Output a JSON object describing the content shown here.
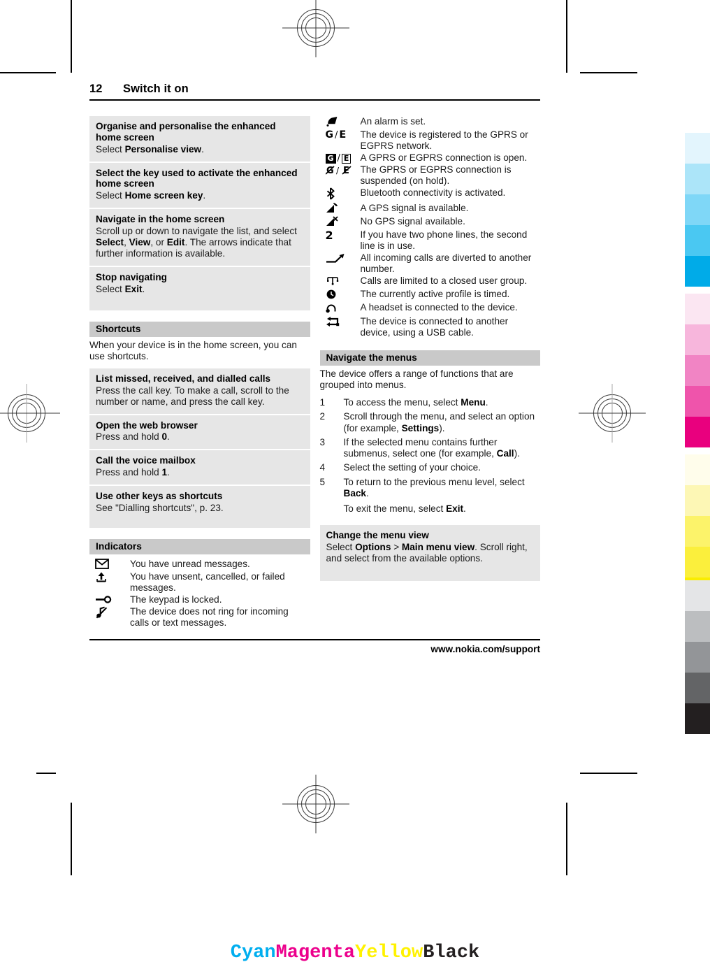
{
  "page": {
    "number": "12",
    "title": "Switch it on",
    "footer": "www.nokia.com/support"
  },
  "left_column": {
    "boxes": [
      {
        "heading": "Organise and personalise the enhanced home screen",
        "body_prefix": "Select ",
        "body_bold": "Personalise view",
        "body_suffix": "."
      },
      {
        "heading": "Select the key used to activate the enhanced home screen",
        "body_prefix": "Select ",
        "body_bold": "Home screen key",
        "body_suffix": "."
      },
      {
        "heading": "Navigate in the home screen",
        "body_prefix": "Scroll up or down to navigate the list, and select ",
        "body_bold": "Select",
        "body_mid1": ", ",
        "body_bold2": "View",
        "body_mid2": ", or ",
        "body_bold3": "Edit",
        "body_suffix": ". The arrows indicate that further information is available."
      },
      {
        "heading": "Stop navigating",
        "body_prefix": "Select ",
        "body_bold": "Exit",
        "body_suffix": "."
      }
    ],
    "shortcuts": {
      "band_title": "Shortcuts",
      "intro": "When your device is in the home screen, you can use shortcuts.",
      "boxes": [
        {
          "heading": "List missed, received, and dialled calls",
          "body": "Press the call key. To make a call, scroll to the number or name, and press the call key."
        },
        {
          "heading": "Open the web browser",
          "body_prefix": "Press and hold ",
          "body_bold": "0",
          "body_suffix": "."
        },
        {
          "heading": "Call the voice mailbox",
          "body_prefix": "Press and hold ",
          "body_bold": "1",
          "body_suffix": "."
        },
        {
          "heading": "Use other keys as shortcuts",
          "body": "See \"Dialling shortcuts\", p. 23."
        }
      ]
    },
    "indicators": {
      "band_title": "Indicators",
      "rows": [
        {
          "icon": "envelope-icon",
          "text": "You have unread messages."
        },
        {
          "icon": "outbox-arrow-up-icon",
          "text": "You have unsent, cancelled, or failed messages."
        },
        {
          "icon": "keypad-lock-key-icon",
          "text": "The keypad is locked."
        },
        {
          "icon": "silent-note-icon",
          "text": "The device does not ring for incoming calls or text messages."
        }
      ]
    }
  },
  "right_column": {
    "indicators": {
      "rows": [
        {
          "icon": "alarm-bell-icon",
          "text": "An alarm is set."
        },
        {
          "icon": "gprs-egprs-registered-icon",
          "text": "The device is registered to the GPRS or EGPRS network."
        },
        {
          "icon": "gprs-egprs-connection-open-icon",
          "text": "A GPRS or EGPRS connection is open."
        },
        {
          "icon": "gprs-egprs-suspended-icon",
          "text": "The GPRS or EGPRS connection is suspended (on hold)."
        },
        {
          "icon": "bluetooth-icon",
          "text": "Bluetooth connectivity is activated."
        },
        {
          "icon": "gps-signal-available-icon",
          "text": "A GPS signal is available."
        },
        {
          "icon": "gps-no-signal-icon",
          "text": "No GPS signal available."
        },
        {
          "icon": "line-two-icon",
          "text": "If you have two phone lines, the second line is in use."
        },
        {
          "icon": "call-divert-arrow-icon",
          "text": "All incoming calls are diverted to another number."
        },
        {
          "icon": "closed-user-group-icon",
          "text": "Calls are limited to a closed user group."
        },
        {
          "icon": "timed-profile-clock-icon",
          "text": "The currently active profile is timed."
        },
        {
          "icon": "headset-icon",
          "text": "A headset is connected to the device."
        },
        {
          "icon": "usb-cable-icon",
          "text": "The device is connected to another device, using a USB cable."
        }
      ]
    },
    "navigate_menus": {
      "band_title": "Navigate the menus",
      "intro": "The device offers a range of functions that are grouped into menus.",
      "steps": [
        {
          "n": "1",
          "prefix": "To access the menu, select ",
          "bold": "Menu",
          "suffix": "."
        },
        {
          "n": "2",
          "prefix": "Scroll through the menu, and select an option (for example, ",
          "bold": "Settings",
          "suffix": ")."
        },
        {
          "n": "3",
          "prefix": "If the selected menu contains further submenus, select one (for example, ",
          "bold": "Call",
          "suffix": ")."
        },
        {
          "n": "4",
          "prefix": "Select the setting of your choice.",
          "bold": "",
          "suffix": ""
        },
        {
          "n": "5",
          "prefix": "To return to the previous menu level, select ",
          "bold": "Back",
          "suffix": "."
        }
      ],
      "exit_prefix": "To exit the menu, select ",
      "exit_bold": "Exit",
      "exit_suffix": "."
    },
    "change_menu_view": {
      "heading": "Change the menu view",
      "body_prefix": "Select ",
      "body_bold1": "Options",
      "body_mid": " > ",
      "body_bold2": "Main menu view",
      "body_suffix": ". Scroll right, and select from the available options."
    }
  },
  "print_marks": {
    "cmyk_labels": [
      "Cyan",
      "Magenta",
      "Yellow",
      "Black"
    ],
    "cmyk_colors": [
      "#00aeef",
      "#ec008c",
      "#fff200",
      "#231f20"
    ],
    "cyan_ramp": [
      "#e3f5fd",
      "#ace5f9",
      "#7fd7f7",
      "#4ac8f2",
      "#00abe8"
    ],
    "magenta_ramp": [
      "#fbe6f2",
      "#f7b6dc",
      "#f184c4",
      "#ef54ab",
      "#e9007e"
    ],
    "yellow_ramp": [
      "#fffdeb",
      "#fdf7b5",
      "#fcf36a",
      "#fbef3c",
      "#faed00"
    ],
    "black_ramp": [
      "#e4e5e7",
      "#bcbec0",
      "#939598",
      "#636466",
      "#231f20"
    ]
  }
}
